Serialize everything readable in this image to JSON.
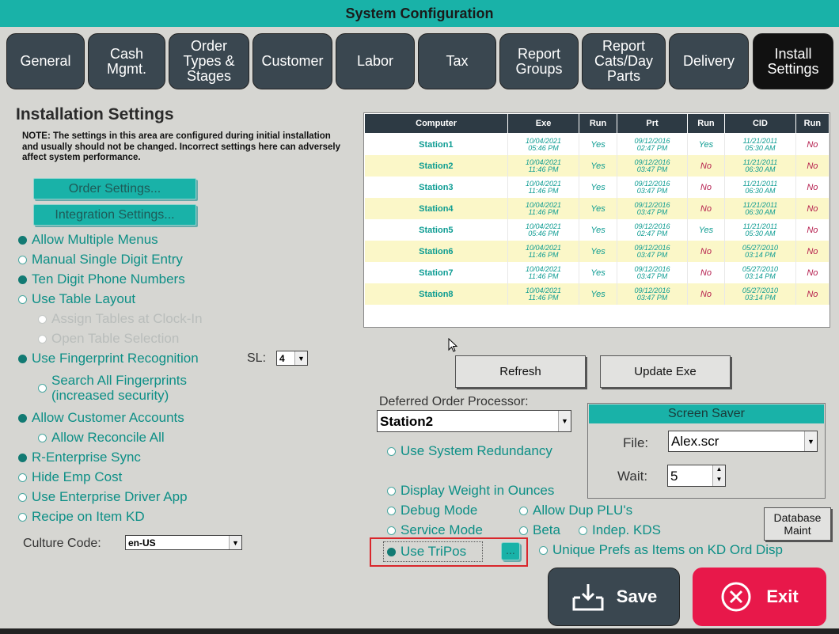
{
  "window": {
    "title": "System Configuration"
  },
  "tabs": [
    {
      "label": "General"
    },
    {
      "label": "Cash\nMgmt."
    },
    {
      "label": "Order\nTypes &\nStages"
    },
    {
      "label": "Customer"
    },
    {
      "label": "Labor"
    },
    {
      "label": "Tax"
    },
    {
      "label": "Report\nGroups"
    },
    {
      "label": "Report\nCats/Day\nParts"
    },
    {
      "label": "Delivery"
    },
    {
      "label": "Install\nSettings"
    }
  ],
  "section": {
    "title": "Installation Settings",
    "note": "NOTE: The settings in this area are configured during initial installation and usually should not be changed. Incorrect settings here can adversely affect system performance."
  },
  "buttons": {
    "order_settings": "Order Settings...",
    "integration_settings": "Integration Settings...",
    "refresh": "Refresh",
    "update_exe": "Update Exe",
    "database_maint": "Database\nMaint",
    "tripos_more": "...",
    "save": "Save",
    "exit": "Exit"
  },
  "options_left": [
    {
      "label": "Allow Multiple Menus",
      "checked": true
    },
    {
      "label": "Manual Single Digit Entry",
      "checked": false
    },
    {
      "label": "Ten Digit Phone Numbers",
      "checked": true
    },
    {
      "label": "Use Table Layout",
      "checked": false
    },
    {
      "label": "Assign Tables at Clock-In",
      "checked": false,
      "disabled": true
    },
    {
      "label": "Open Table Selection",
      "checked": false,
      "disabled": true
    },
    {
      "label": "Use Fingerprint Recognition",
      "checked": true
    },
    {
      "label": "Search All Fingerprints\n(increased security)",
      "checked": false
    },
    {
      "label": "Allow Customer Accounts",
      "checked": true
    },
    {
      "label": "Allow Reconcile All",
      "checked": false
    },
    {
      "label": "R-Enterprise Sync",
      "checked": true
    },
    {
      "label": "Hide Emp Cost",
      "checked": false
    },
    {
      "label": "Use Enterprise Driver App",
      "checked": false
    },
    {
      "label": "Recipe on Item KD",
      "checked": false
    }
  ],
  "sl": {
    "label": "SL:",
    "value": "4"
  },
  "culture": {
    "label": "Culture Code:",
    "value": "en-US"
  },
  "grid": {
    "columns": [
      "Computer",
      "Exe",
      "Run",
      "Prt",
      "Run",
      "CID",
      "Run"
    ],
    "rows": [
      {
        "computer": "Station1",
        "exe": [
          "10/04/2021",
          "05:46 PM"
        ],
        "run1": "Yes",
        "prt": [
          "09/12/2016",
          "02:47 PM"
        ],
        "run2": "Yes",
        "cid": [
          "11/21/2011",
          "05:30 AM"
        ],
        "run3": "No"
      },
      {
        "computer": "Station2",
        "exe": [
          "10/04/2021",
          "11:46 PM"
        ],
        "run1": "Yes",
        "prt": [
          "09/12/2016",
          "03:47 PM"
        ],
        "run2": "No",
        "cid": [
          "11/21/2011",
          "06:30 AM"
        ],
        "run3": "No"
      },
      {
        "computer": "Station3",
        "exe": [
          "10/04/2021",
          "11:46 PM"
        ],
        "run1": "Yes",
        "prt": [
          "09/12/2016",
          "03:47 PM"
        ],
        "run2": "No",
        "cid": [
          "11/21/2011",
          "06:30 AM"
        ],
        "run3": "No"
      },
      {
        "computer": "Station4",
        "exe": [
          "10/04/2021",
          "11:46 PM"
        ],
        "run1": "Yes",
        "prt": [
          "09/12/2016",
          "03:47 PM"
        ],
        "run2": "No",
        "cid": [
          "11/21/2011",
          "06:30 AM"
        ],
        "run3": "No"
      },
      {
        "computer": "Station5",
        "exe": [
          "10/04/2021",
          "05:46 PM"
        ],
        "run1": "Yes",
        "prt": [
          "09/12/2016",
          "02:47 PM"
        ],
        "run2": "Yes",
        "cid": [
          "11/21/2011",
          "05:30 AM"
        ],
        "run3": "No"
      },
      {
        "computer": "Station6",
        "exe": [
          "10/04/2021",
          "11:46 PM"
        ],
        "run1": "Yes",
        "prt": [
          "09/12/2016",
          "03:47 PM"
        ],
        "run2": "No",
        "cid": [
          "05/27/2010",
          "03:14 PM"
        ],
        "run3": "No"
      },
      {
        "computer": "Station7",
        "exe": [
          "10/04/2021",
          "11:46 PM"
        ],
        "run1": "Yes",
        "prt": [
          "09/12/2016",
          "03:47 PM"
        ],
        "run2": "No",
        "cid": [
          "05/27/2010",
          "03:14 PM"
        ],
        "run3": "No"
      },
      {
        "computer": "Station8",
        "exe": [
          "10/04/2021",
          "11:46 PM"
        ],
        "run1": "Yes",
        "prt": [
          "09/12/2016",
          "03:47 PM"
        ],
        "run2": "No",
        "cid": [
          "05/27/2010",
          "03:14 PM"
        ],
        "run3": "No"
      }
    ]
  },
  "deferred": {
    "label": "Deferred Order Processor:",
    "value": "Station2"
  },
  "screen_saver": {
    "title": "Screen Saver",
    "file_label": "File:",
    "file_value": "Alex.scr",
    "wait_label": "Wait:",
    "wait_value": "5"
  },
  "options_right": {
    "use_system_redundancy": "Use System Redundancy",
    "display_weight": "Display Weight in Ounces",
    "debug_mode": "Debug Mode",
    "allow_dup_plu": "Allow Dup PLU's",
    "service_mode": "Service Mode",
    "beta": "Beta",
    "indep_kds": "Indep. KDS",
    "use_tripos": "Use TriPos",
    "unique_prefs": "Unique Prefs as Items on KD Ord Disp"
  },
  "icons": {
    "save": "tray-download-icon",
    "exit": "x-circle-icon",
    "dropdown": "chevron-down-icon"
  },
  "colors": {
    "accent": "#19b2a8",
    "exit": "#e8184a",
    "save": "#3a4750",
    "highlight_border": "#d9262b"
  }
}
